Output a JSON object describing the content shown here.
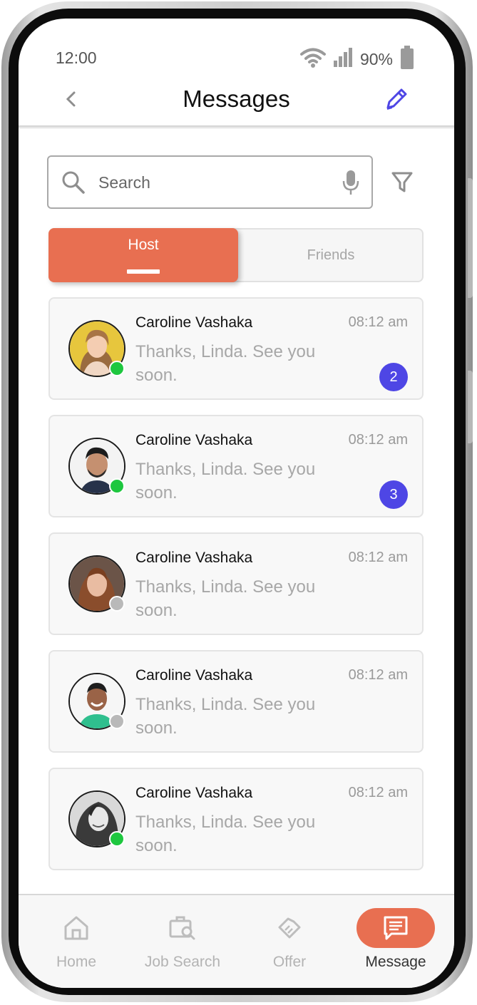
{
  "status_bar": {
    "time": "12:00",
    "battery_pct": "90%"
  },
  "header": {
    "title": "Messages"
  },
  "search": {
    "placeholder": "Search"
  },
  "tabs": [
    {
      "label": "Host",
      "selected": true
    },
    {
      "label": "Friends",
      "selected": false
    }
  ],
  "messages": [
    {
      "sender": "Caroline Vashaka",
      "time": "08:12 am",
      "preview": "Thanks, Linda. See you soon.",
      "unread": "2",
      "online": true
    },
    {
      "sender": "Caroline Vashaka",
      "time": "08:12 am",
      "preview": "Thanks, Linda. See you soon.",
      "unread": "3",
      "online": true
    },
    {
      "sender": "Caroline Vashaka",
      "time": "08:12 am",
      "preview": "Thanks, Linda. See you soon.",
      "unread": "",
      "online": false
    },
    {
      "sender": "Caroline Vashaka",
      "time": "08:12 am",
      "preview": "Thanks, Linda. See you soon.",
      "unread": "",
      "online": false
    },
    {
      "sender": "Caroline Vashaka",
      "time": "08:12 am",
      "preview": "Thanks, Linda. See you soon.",
      "unread": "",
      "online": true
    }
  ],
  "bottom_nav": [
    {
      "label": "Home",
      "icon": "home-icon",
      "active": false
    },
    {
      "label": "Job Search",
      "icon": "job-search-icon",
      "active": false
    },
    {
      "label": "Offer",
      "icon": "handshake-icon",
      "active": false
    },
    {
      "label": "Message",
      "icon": "message-icon",
      "active": true
    }
  ],
  "colors": {
    "accent": "#e86f51",
    "badge": "#4e46e5",
    "edit_icon": "#4e46e5",
    "online": "#1ec73f",
    "offline": "#b9b9b9"
  }
}
